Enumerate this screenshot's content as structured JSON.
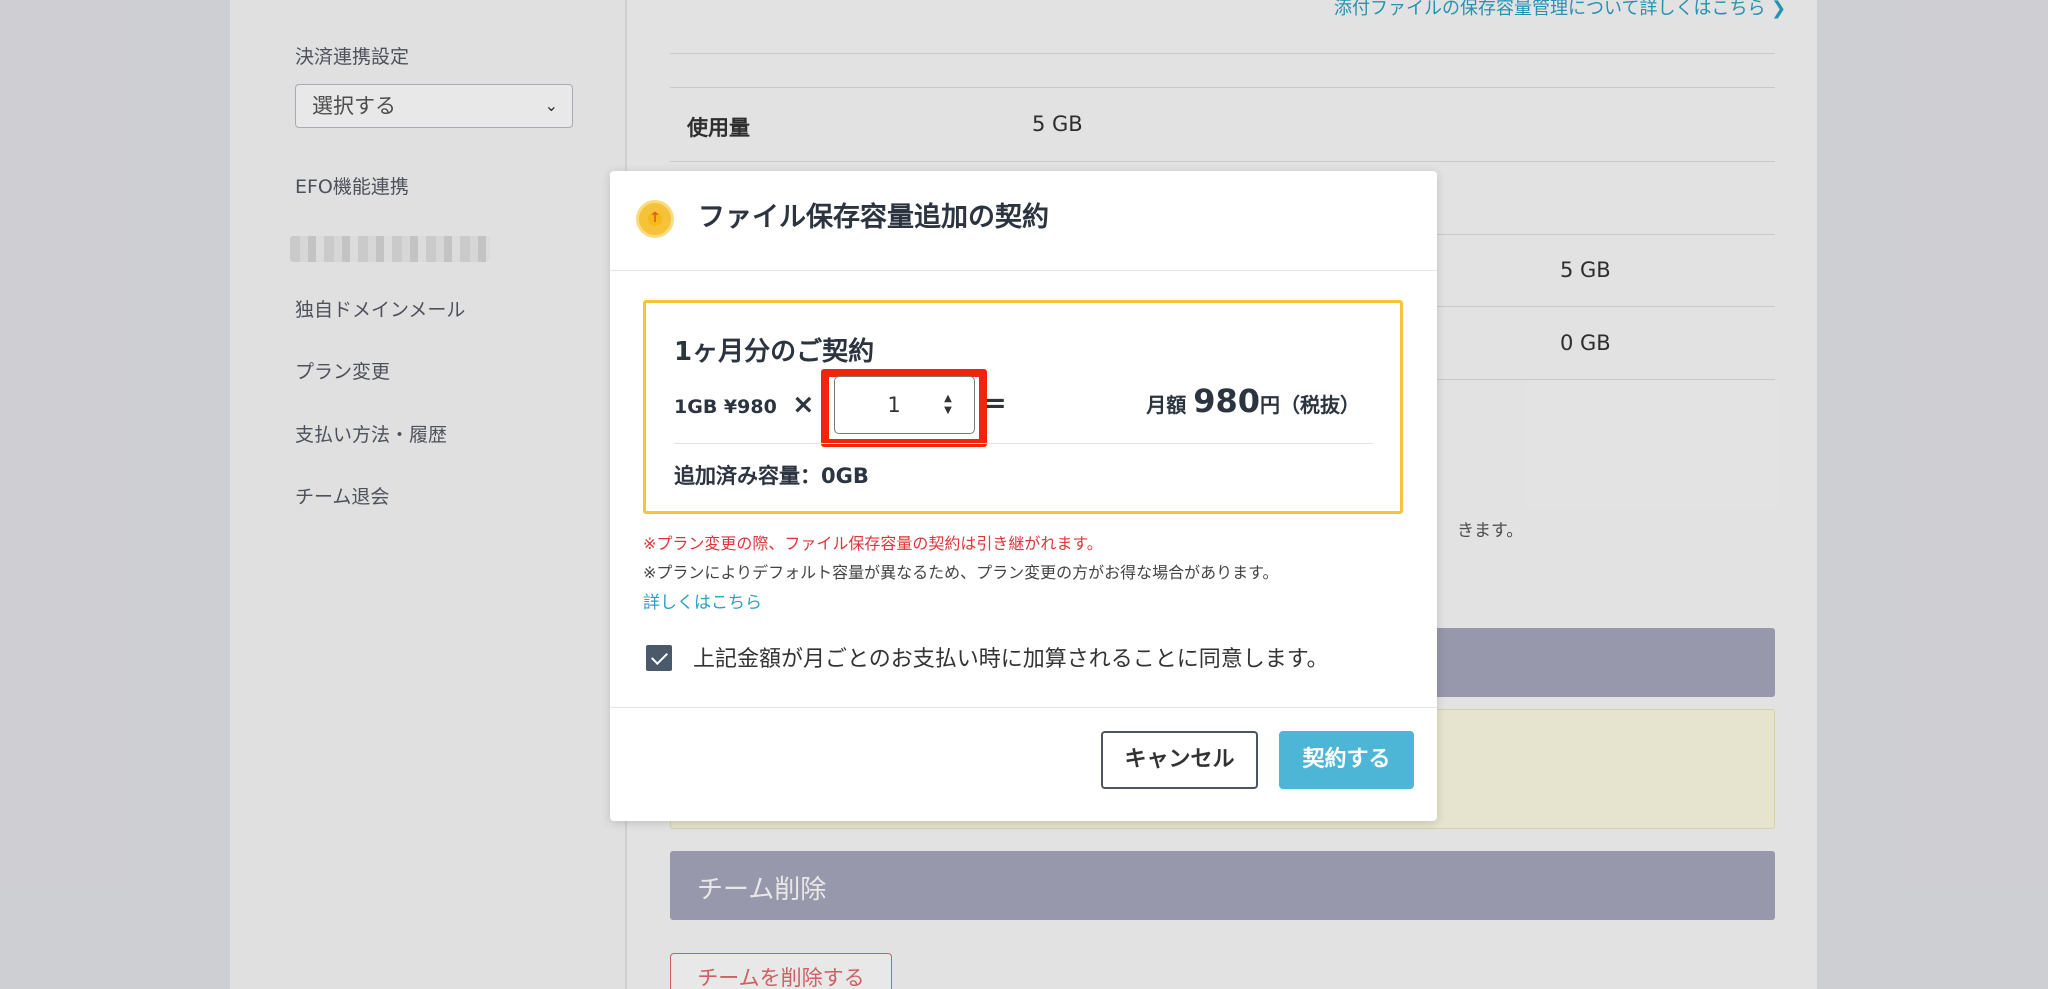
{
  "sidebar": {
    "payment_link_label": "決済連携設定",
    "payment_select_value": "選択する",
    "items": [
      {
        "label": "EFO機能連携"
      },
      {
        "label": "独自ドメインメール"
      },
      {
        "label": "プラン変更"
      },
      {
        "label": "支払い方法・履歴"
      },
      {
        "label": "チーム退会"
      }
    ]
  },
  "content": {
    "storage_link": "添付ファイルの保存容量管理について詳しくはこちら ❯",
    "usage_label": "使用量",
    "usage_value": "5 GB",
    "row2_value": "5 GB",
    "row3_value": "0 GB",
    "partial_note": "きます。",
    "delete_section_title": "チーム削除",
    "delete_button": "チームを削除する"
  },
  "modal": {
    "title": "ファイル保存容量追加の契約",
    "box_heading": "1ヶ月分のご契約",
    "unit_price": "1GB ¥980",
    "times": "×",
    "quantity": "1",
    "equals": "=",
    "monthly_prefix": "月額",
    "monthly_amount": "980",
    "monthly_suffix": "円（税抜）",
    "added_capacity": "追加済み容量：0GB",
    "note_red": "※プラン変更の際、ファイル保存容量の契約は引き継がれます。",
    "note_gray": "※プランによりデフォルト容量が異なるため、プラン変更の方がお得な場合があります。",
    "more_link": "詳しくはこちら",
    "agree_text": "上記金額が月ごとのお支払い時に加算されることに同意します。",
    "agree_checked": true,
    "cancel_label": "キャンセル",
    "submit_label": "契約する"
  },
  "colors": {
    "accent": "#4db6d6",
    "highlight": "#f4230e",
    "box_border": "#f7c23c",
    "section_bar": "#a6a8bc"
  }
}
